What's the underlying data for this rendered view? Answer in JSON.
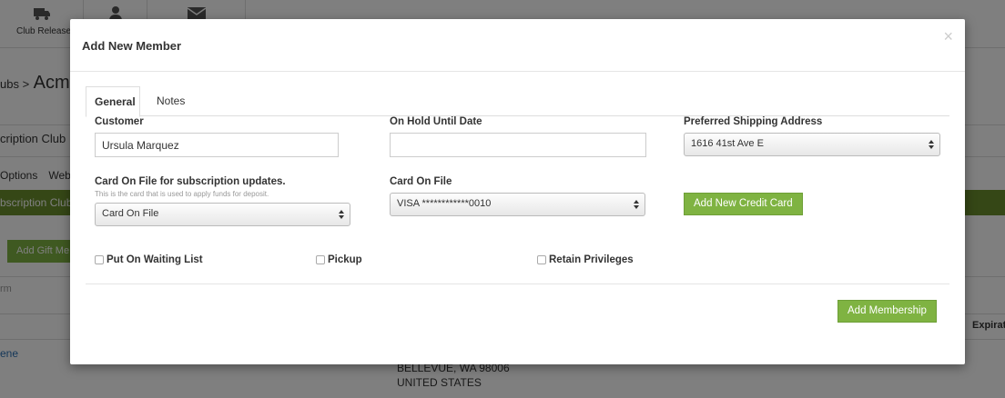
{
  "background": {
    "nav_release_label": "Club Release",
    "breadcrumb_prefix": "ubs >",
    "breadcrumb_name": "Acme",
    "subtitle": "cription Club",
    "tabs": [
      "Options",
      "Web"
    ],
    "green_bar_text": "bscription Club",
    "gift_button": "Add Gift Me",
    "term_header": "rm",
    "expiration_header": "Expirat",
    "member_link": "ene",
    "address_line1": "BELLEVUE, WA 98006",
    "address_line2": "UNITED STATES"
  },
  "modal": {
    "title": "Add New Member",
    "close_glyph": "×",
    "tabs": [
      {
        "label": "General",
        "active": true
      },
      {
        "label": "Notes",
        "active": false
      }
    ],
    "customer": {
      "label": "Customer",
      "value": "Ursula Marquez"
    },
    "on_hold": {
      "label": "On Hold Until Date",
      "value": ""
    },
    "shipping": {
      "label": "Preferred Shipping Address",
      "selected": "1616 41st Ave E"
    },
    "card_subscription": {
      "label": "Card On File for subscription updates.",
      "hint": "This is the card that is used to apply funds for deposit.",
      "selected": "Card On File"
    },
    "card_on_file": {
      "label": "Card On File",
      "selected": "VISA ************0010"
    },
    "add_card_button": "Add New Credit Card",
    "checkboxes": [
      {
        "label": "Put On Waiting List",
        "checked": false
      },
      {
        "label": "Pickup",
        "checked": false
      },
      {
        "label": "Retain Privileges",
        "checked": false
      }
    ],
    "add_membership_button": "Add Membership"
  },
  "colors": {
    "accent_green": "#7fb342",
    "overlay": "rgba(0,0,0,0.5)"
  }
}
